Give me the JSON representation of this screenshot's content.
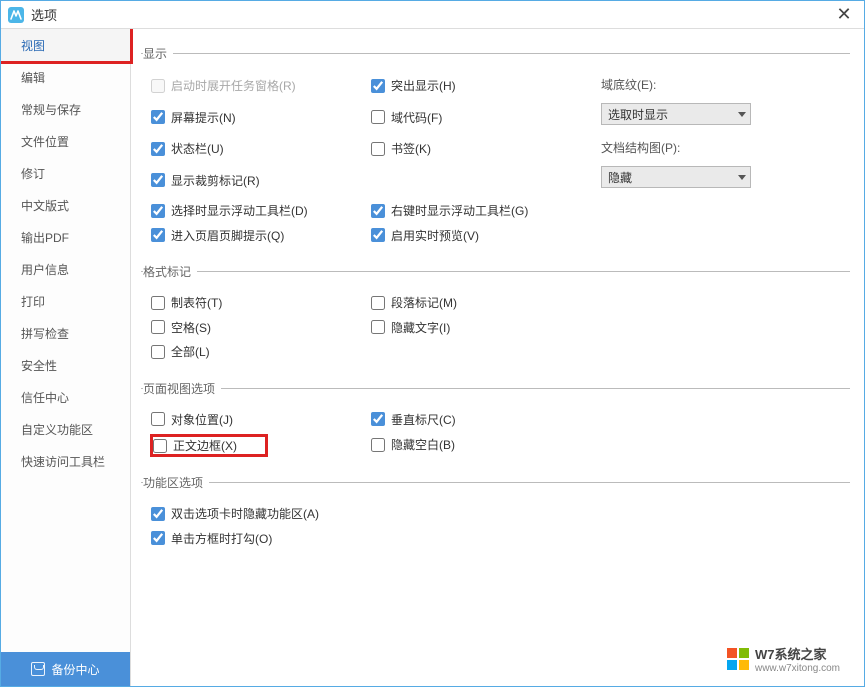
{
  "window": {
    "title": "选项"
  },
  "sidebar": {
    "items": [
      "视图",
      "编辑",
      "常规与保存",
      "文件位置",
      "修订",
      "中文版式",
      "输出PDF",
      "用户信息",
      "打印",
      "拼写检查",
      "安全性",
      "信任中心",
      "自定义功能区",
      "快速访问工具栏"
    ],
    "backup_label": "备份中心"
  },
  "groups": {
    "display": {
      "legend": "显示"
    },
    "format": {
      "legend": "格式标记"
    },
    "pageview": {
      "legend": "页面视图选项"
    },
    "ribbon": {
      "legend": "功能区选项"
    }
  },
  "checks": {
    "startup_task_pane": "启动时展开任务窗格(R)",
    "screen_tips": "屏幕提示(N)",
    "status_bar": "状态栏(U)",
    "crop_marks": "显示裁剪标记(R)",
    "float_toolbar_select": "选择时显示浮动工具栏(D)",
    "header_footer_hint": "进入页眉页脚提示(Q)",
    "highlight": "突出显示(H)",
    "field_codes": "域代码(F)",
    "bookmarks": "书签(K)",
    "float_toolbar_rclick": "右键时显示浮动工具栏(G)",
    "live_preview": "启用实时预览(V)",
    "tab_chars": "制表符(T)",
    "spaces": "空格(S)",
    "all": "全部(L)",
    "para_marks": "段落标记(M)",
    "hidden_text": "隐藏文字(I)",
    "object_anchors": "对象位置(J)",
    "text_boundaries": "正文边框(X)",
    "vertical_ruler": "垂直标尺(C)",
    "hide_whitespace": "隐藏空白(B)",
    "dblclick_hide_ribbon": "双击选项卡时隐藏功能区(A)",
    "click_checkbox_tick": "单击方框时打勾(O)"
  },
  "labels": {
    "field_shading": "域底纹(E):",
    "doc_map": "文档结构图(P):"
  },
  "selects": {
    "field_shading_value": "选取时显示",
    "doc_map_value": "隐藏"
  },
  "watermark": {
    "text": "W7系统之家",
    "url": "www.w7xitong.com"
  }
}
